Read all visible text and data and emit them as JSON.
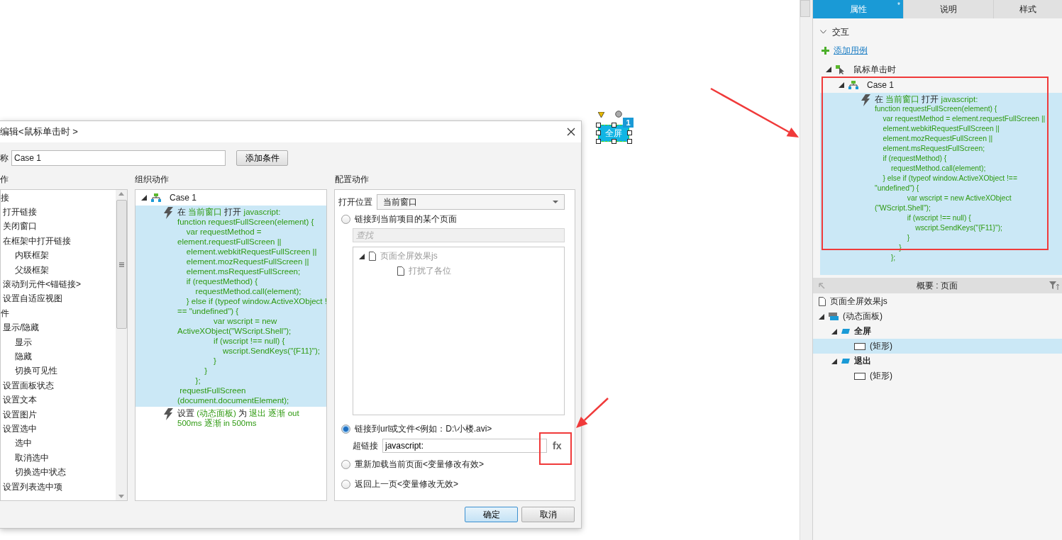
{
  "canvas": {
    "widget": {
      "label": "全屏",
      "selected": true,
      "badge": "1"
    }
  },
  "dialog": {
    "title": "编辑<鼠标单击时 >",
    "name_label": "称",
    "name_value": "Case 1",
    "add_condition_button": "添加条件",
    "actions_heading": "作",
    "organize_heading": "组织动作",
    "configure_heading": "配置动作",
    "actions_tree": [
      {
        "label": "接",
        "children": [
          {
            "label": "打开链接"
          },
          {
            "label": "关闭窗口"
          },
          {
            "label": "在框架中打开链接",
            "children": [
              {
                "label": "内联框架"
              },
              {
                "label": "父级框架"
              }
            ]
          },
          {
            "label": "滚动到元件<锚链接>"
          },
          {
            "label": "设置自适应视图"
          }
        ]
      },
      {
        "label": "件",
        "children": [
          {
            "label": "显示/隐藏",
            "children": [
              {
                "label": "显示"
              },
              {
                "label": "隐藏"
              },
              {
                "label": "切换可见性"
              }
            ]
          },
          {
            "label": "设置面板状态"
          },
          {
            "label": "设置文本"
          },
          {
            "label": "设置图片"
          },
          {
            "label": "设置选中",
            "children": [
              {
                "label": "选中"
              },
              {
                "label": "取消选中"
              },
              {
                "label": "切换选中状态"
              }
            ]
          },
          {
            "label": "设置列表选中项"
          }
        ]
      }
    ],
    "organize": {
      "case": "Case 1",
      "expanded": true,
      "actions": [
        {
          "selected": true,
          "parts": [
            {
              "kind": "plain",
              "text": "在"
            },
            {
              "kind": "value",
              "text": "当前窗口"
            },
            {
              "kind": "plain",
              "text": "打开"
            },
            {
              "kind": "value",
              "text": "javascript:"
            }
          ],
          "code": [
            "function requestFullScreen(element) {",
            "    var requestMethod =",
            "element.requestFullScreen ||",
            "    element.webkitRequestFullScreen ||",
            "    element.mozRequestFullScreen ||",
            "    element.msRequestFullScreen;",
            "    if (requestMethod) {",
            "        requestMethod.call(element);",
            "    } else if (typeof window.ActiveXObject !",
            "== \"undefined\") {",
            "                var wscript = new",
            "ActiveXObject(\"WScript.Shell\");",
            "                if (wscript !== null) {",
            "                    wscript.SendKeys(\"{F11}\");",
            "                }",
            "            }",
            "        };",
            " requestFullScreen",
            "(document.documentElement);"
          ]
        },
        {
          "selected": false,
          "parts": [
            {
              "kind": "plain",
              "text": "设置"
            },
            {
              "kind": "value",
              "text": "(动态面板)"
            },
            {
              "kind": "plain",
              "text": "为"
            },
            {
              "kind": "value",
              "text": "退出 逐渐 out 500ms 逐渐 in 500ms"
            }
          ]
        }
      ]
    },
    "configure": {
      "location_label": "打开位置",
      "location_value": "当前窗口",
      "page_option": {
        "label": "链接到当前项目的某个页面",
        "selected": false
      },
      "search": {
        "placeholder": "查找"
      },
      "pages": [
        {
          "label": "页面全屏效果js",
          "disabled": true,
          "children": [
            {
              "label": "打扰了各位",
              "disabled": true
            }
          ]
        }
      ],
      "url_option": {
        "label": "链接到url或文件<例如：D:\\小楼.avi>",
        "selected": true
      },
      "hyperlink_label": "超链接",
      "hyperlink_value": "javascript:",
      "fx_button": "fx",
      "reload_option": {
        "label": "重新加载当前页面<变量修改有效>",
        "selected": false
      },
      "back_option": {
        "label": "返回上一页<变量修改无效>",
        "selected": false
      }
    },
    "buttons": [
      {
        "label": "确定",
        "kind": "primary"
      },
      {
        "label": "取消",
        "kind": "normal"
      }
    ]
  },
  "inspector": {
    "tabs": [
      {
        "label": "属性",
        "selected": true,
        "modified": "*"
      },
      {
        "label": "说明",
        "selected": false
      },
      {
        "label": "样式",
        "selected": false
      }
    ],
    "section": {
      "label": "交互",
      "expanded": true
    },
    "add_case_link": "添加用例",
    "event": "鼠标单击时",
    "case": "Case 1",
    "action": {
      "parts": [
        {
          "kind": "plain",
          "text": "在"
        },
        {
          "kind": "value",
          "text": "当前窗口"
        },
        {
          "kind": "plain",
          "text": "打开"
        },
        {
          "kind": "value",
          "text": "javascript:"
        }
      ],
      "code": [
        "function requestFullScreen(element) {",
        "    var requestMethod = element.requestFullScreen ||",
        "    element.webkitRequestFullScreen ||",
        "    element.mozRequestFullScreen ||",
        "    element.msRequestFullScreen;",
        "    if (requestMethod) {",
        "        requestMethod.call(element);",
        "    } else if (typeof window.ActiveXObject !==",
        "\"undefined\") {",
        "                var wscript = new ActiveXObject",
        "(\"WScript.Shell\");",
        "                if (wscript !== null) {",
        "                    wscript.SendKeys(\"{F11}\");",
        "                }",
        "            }",
        "        };"
      ]
    }
  },
  "outline": {
    "title": "概要 : 页面",
    "page": "页面全屏效果js",
    "tree": [
      {
        "label": "(动态面板)",
        "kind": "panel",
        "selected": false,
        "children": [
          {
            "label": "全屏",
            "kind": "state",
            "selected": false,
            "children": [
              {
                "label": "(矩形)",
                "kind": "rect",
                "selected": true
              }
            ]
          },
          {
            "label": "退出",
            "kind": "state",
            "selected": false,
            "children": [
              {
                "label": "(矩形)",
                "kind": "rect",
                "selected": false
              }
            ]
          }
        ]
      }
    ]
  }
}
